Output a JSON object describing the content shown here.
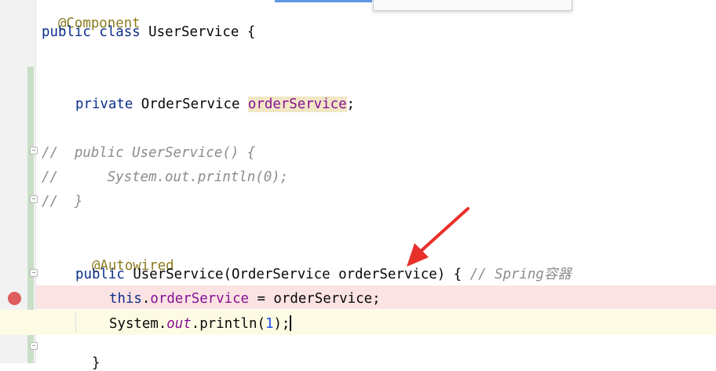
{
  "code_lines": {
    "l1": {
      "annotation": "@Component"
    },
    "l2": {
      "kw1": "public",
      "kw2": "class",
      "name": "UserService",
      "brace": "{"
    },
    "l3": {
      "kw": "private",
      "type": "OrderService",
      "field": "orderService",
      "semi": ";"
    },
    "l4": {
      "text": "//  public UserService() {"
    },
    "l5": {
      "text": "//      System.out.println(0);"
    },
    "l6": {
      "text": "//  }"
    },
    "l7": {
      "annotation": "@Autowired"
    },
    "l8": {
      "kw": "public",
      "sig": "UserService(OrderService orderService) {",
      "comment": "// Spring容器"
    },
    "l9": {
      "kw": "this",
      "dot": ".",
      "field": "orderService",
      "rest": " = orderService;"
    },
    "l10": {
      "p1": "System.",
      "static": "out",
      "p2": ".println(",
      "num": "1",
      "p3": ");"
    },
    "l11": {
      "text": "}"
    }
  },
  "icons": {
    "breakpoint": "breakpoint-icon",
    "fold": "fold-marker-icon",
    "arrow": "red-arrow-annotation"
  },
  "colors": {
    "keyword": "#0b2e8a",
    "annotation": "#8b7a1e",
    "comment": "#8c8c8c",
    "field": "#871094",
    "number": "#1750eb",
    "breakpoint": "#df5c5c",
    "arrow": "#e8302a"
  }
}
